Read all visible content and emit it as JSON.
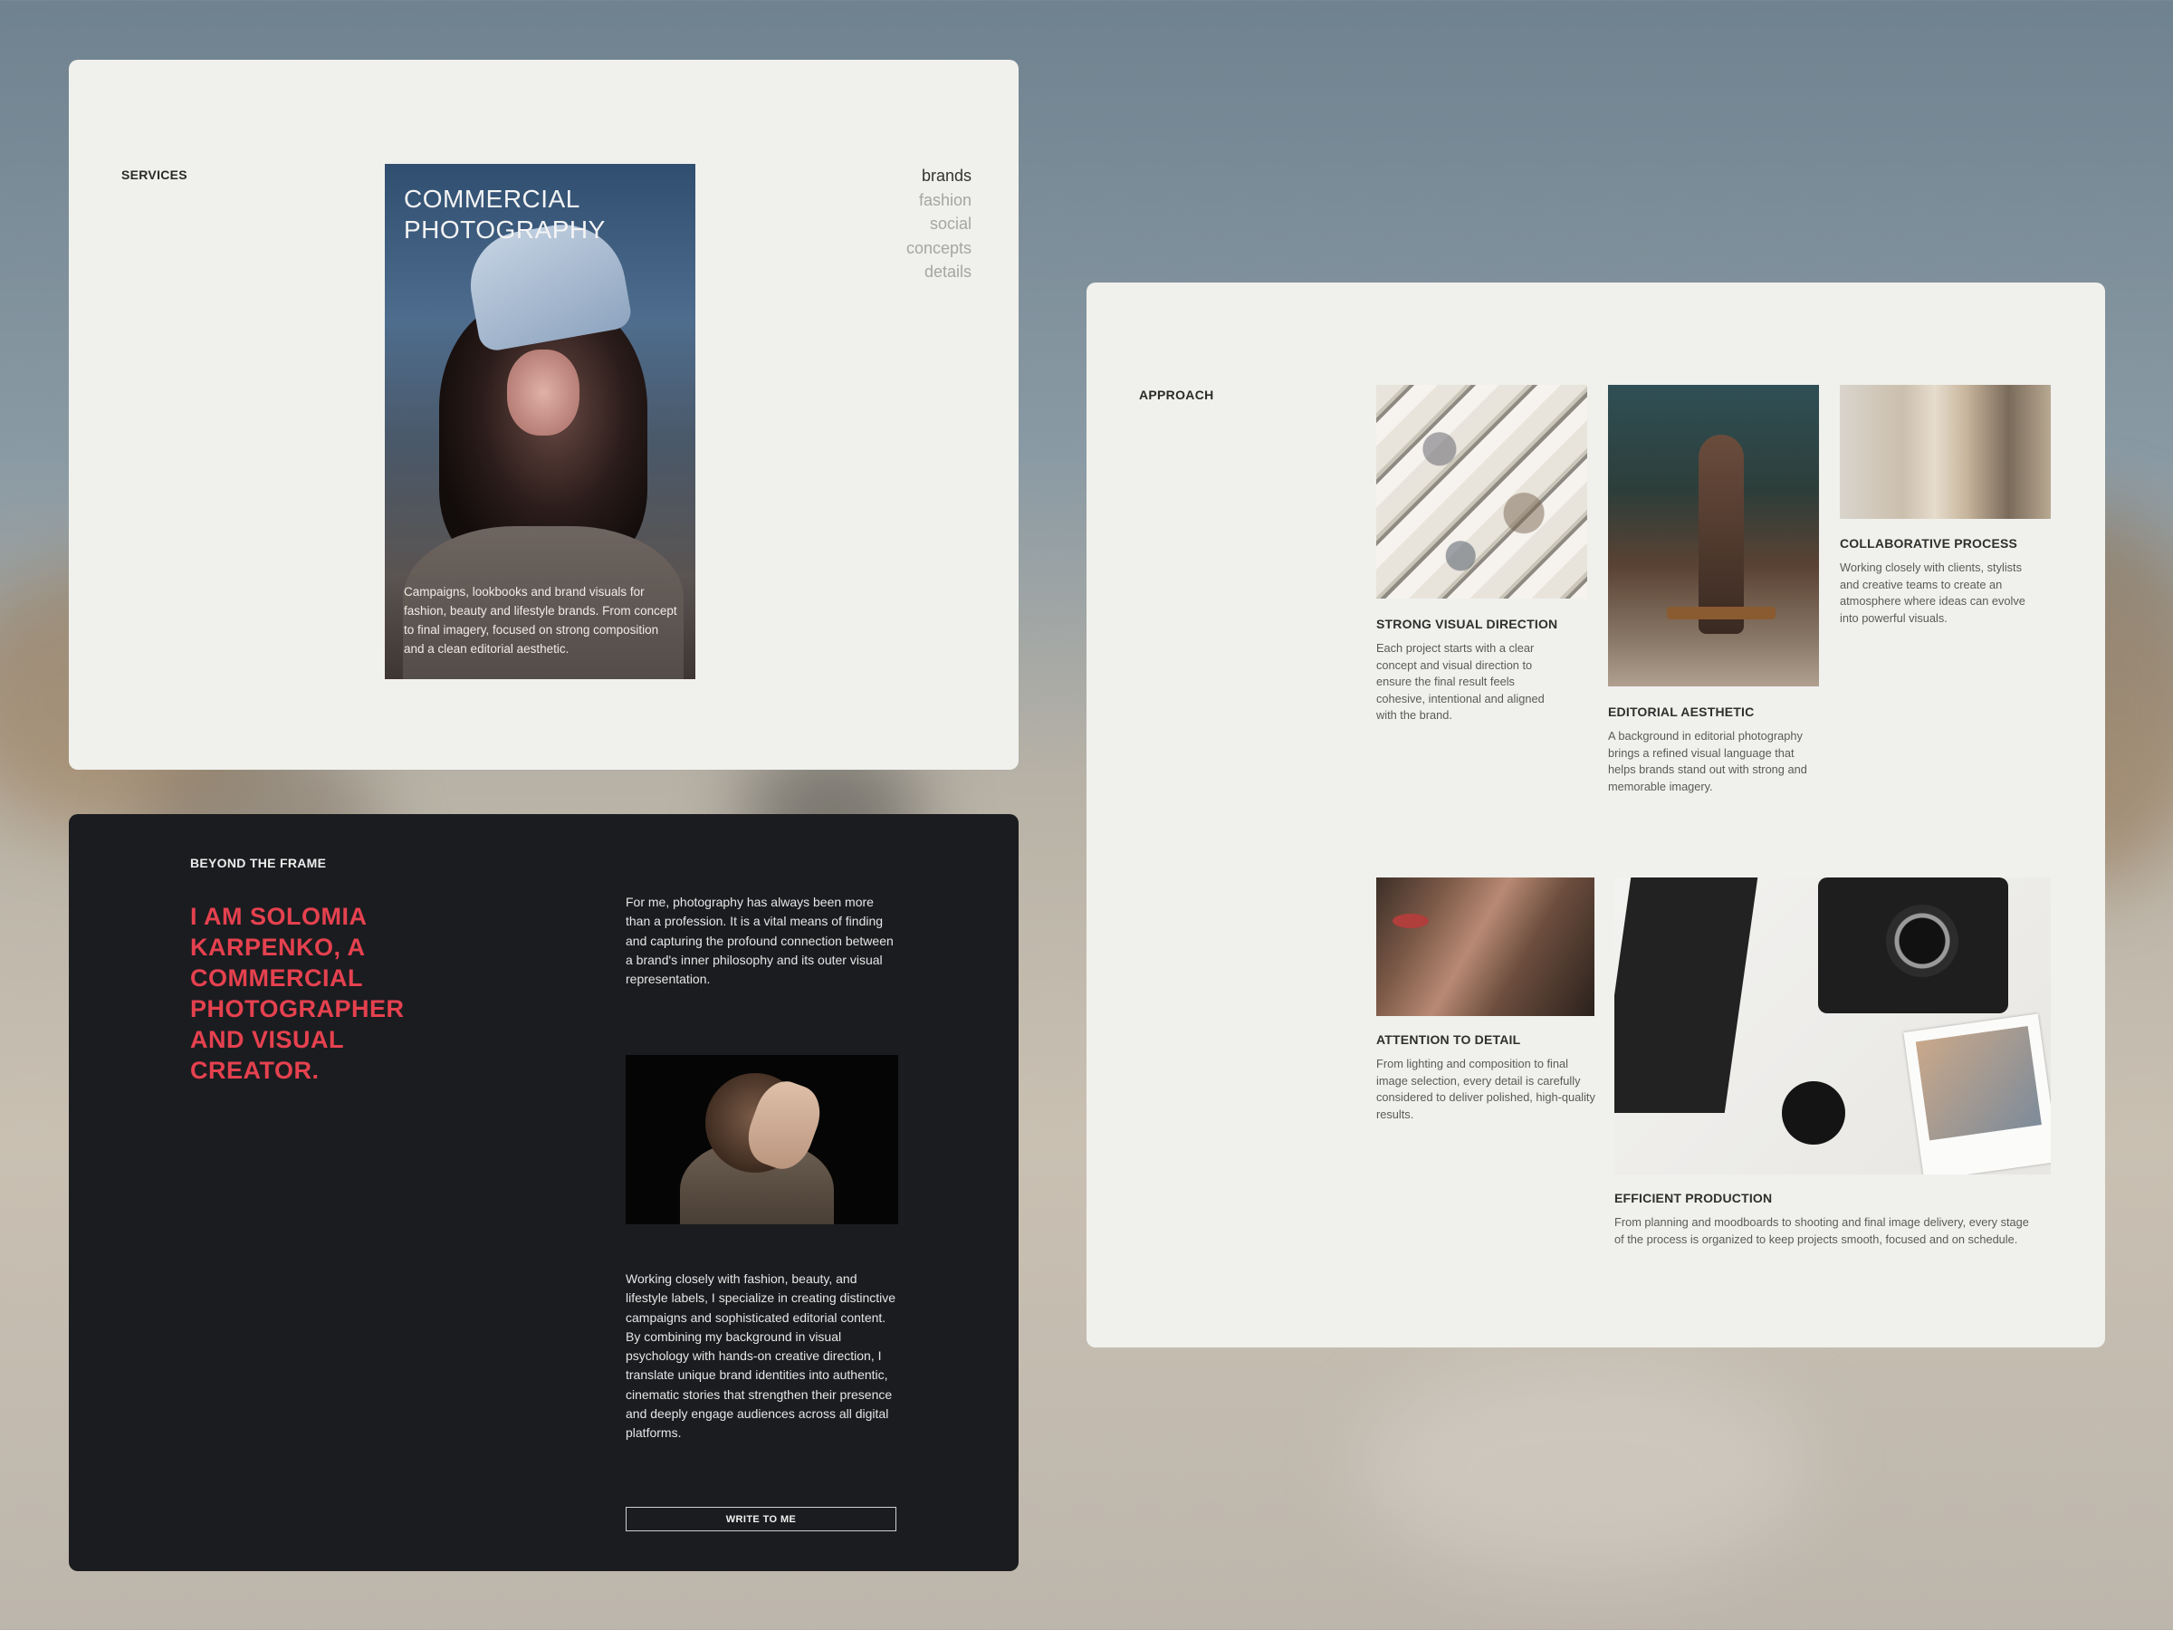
{
  "services": {
    "eyebrow": "SERVICES",
    "hero_title": "COMMERCIAL PHOTOGRAPHY",
    "hero_description": "Campaigns, lookbooks and brand visuals for fashion, beauty and lifestyle brands. From concept to final imagery, focused on strong composition and a clean editorial aesthetic.",
    "nav": [
      "brands",
      "fashion",
      "social",
      "concepts",
      "details"
    ],
    "nav_active": "brands"
  },
  "about": {
    "eyebrow": "BEYOND THE FRAME",
    "headline": "I AM SOLOMIA KARPENKO, A COMMERCIAL PHOTOGRAPHER AND VISUAL CREATOR.",
    "paragraph1": "For me, photography has always been more than a profession. It is a vital means of finding and capturing the profound connection between a brand's inner philosophy and its outer visual representation.",
    "paragraph2": "Working closely with fashion, beauty, and lifestyle labels, I specialize in creating distinctive campaigns and sophisticated editorial content. By combining my background in visual psychology with hands-on creative direction, I translate unique brand identities into authentic, cinematic stories that strengthen their presence and deeply engage audiences across all digital platforms.",
    "button_label": "WRITE TO ME"
  },
  "approach": {
    "eyebrow": "APPROACH",
    "cards": [
      {
        "title": "STRONG VISUAL DIRECTION",
        "text": "Each project starts with a clear concept and visual direction to ensure the final result feels cohesive, intentional and aligned with the brand."
      },
      {
        "title": "EDITORIAL AESTHETIC",
        "text": "A background in editorial photography brings a refined visual language that helps brands stand out with strong and memorable imagery."
      },
      {
        "title": "COLLABORATIVE PROCESS",
        "text": "Working closely with clients, stylists and creative teams to create an atmosphere where ideas can evolve into powerful visuals."
      },
      {
        "title": "ATTENTION TO DETAIL",
        "text": "From lighting and composition to final image selection, every detail is carefully considered to deliver polished, high-quality results."
      },
      {
        "title": "EFFICIENT PRODUCTION",
        "text": "From planning and moodboards to shooting and final image delivery, every stage of the process is organized to keep projects smooth, focused and on schedule."
      }
    ]
  },
  "colors": {
    "accent": "#e5414f",
    "panel_light": "#f0f0ec",
    "panel_dark": "#1b1c1f"
  }
}
